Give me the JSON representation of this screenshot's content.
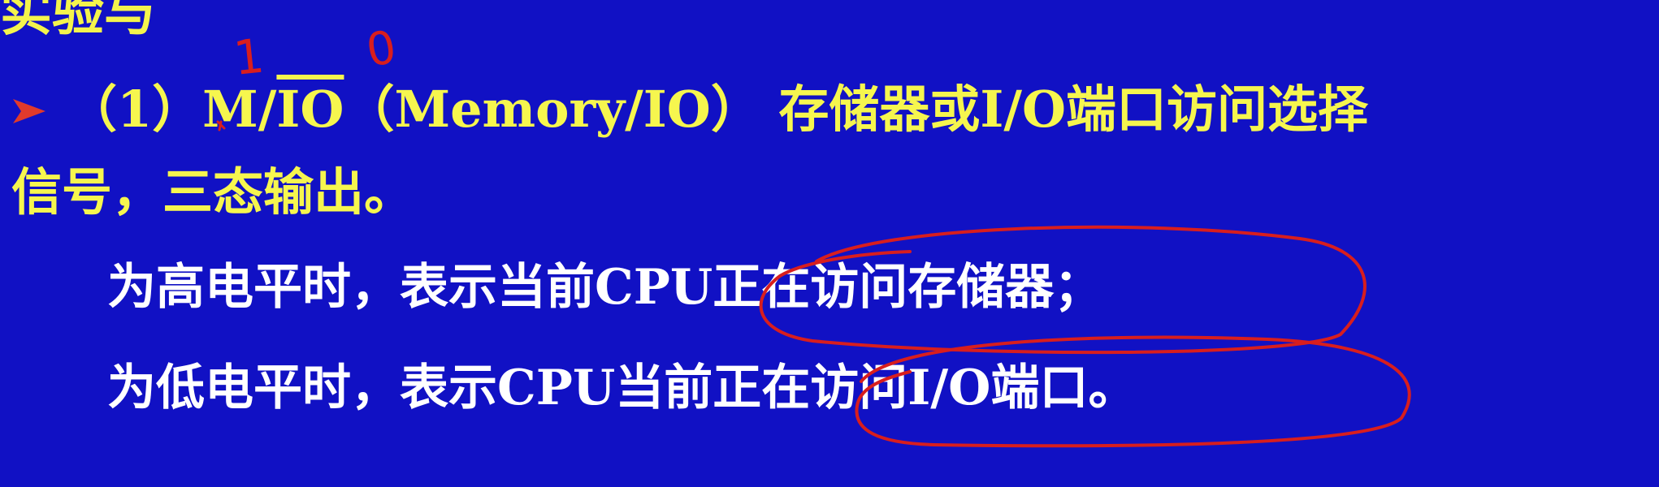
{
  "slide": {
    "top_fragment": "实验与",
    "line1": {
      "prefix": "（1）",
      "signal_m": "M/",
      "signal_io": "IO",
      "after": "（Memory/IO） 存储器或I/O端口访问选择"
    },
    "line2": "信号，三态输出。",
    "line3": "为高电平时，表示当前CPU正在访问存储器；",
    "line4": "为低电平时，表示CPU当前正在访问I/O端口。",
    "handwriting": {
      "one": "1",
      "zero": "0"
    }
  },
  "colors": {
    "background": "#1111c4",
    "heading_text": "#f6f64e",
    "body_text": "#ffffff",
    "annotation_ink": "#d81e1e",
    "bullet": "#e03a2c"
  },
  "icons": {
    "bullet": "arrowhead-bullet-icon"
  }
}
